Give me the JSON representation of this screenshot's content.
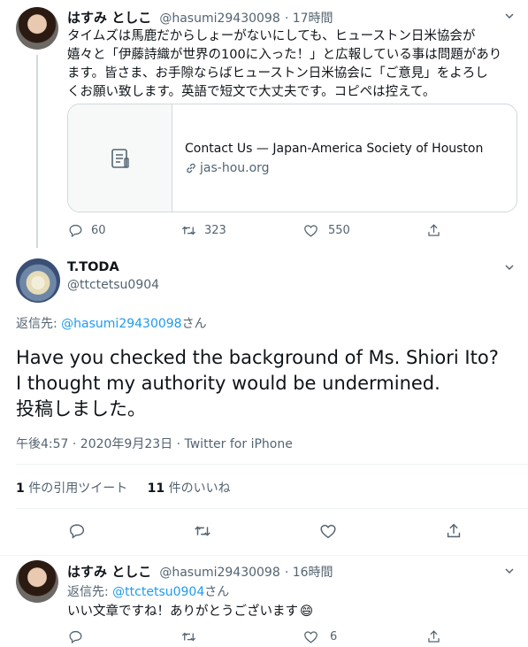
{
  "tweet1": {
    "name": "はすみ としこ",
    "handle": "@hasumi29430098",
    "time": "· 17時間",
    "text_lines": [
      "タイムズは馬鹿だからしょーがないにしても、ヒューストン日米協会が",
      "嬉々と「伊藤詩織が世界の100に入った！」と広報している事は問題があり",
      "ます。皆さま、お手隙ならばヒューストン日米協会に「ご意見」をよろし",
      "くお願い致します。英語で短文で大丈夫です。コピペは控えて。"
    ],
    "card": {
      "title": "Contact Us — Japan-America Society of Houston",
      "domain": "jas-hou.org"
    },
    "replies": "60",
    "retweets": "323",
    "likes": "550"
  },
  "main_tweet": {
    "name": "T.TODA",
    "handle": "@ttctetsu0904",
    "reply_prefix": "返信先: ",
    "reply_to": "@hasumi29430098",
    "reply_suffix": "さん",
    "text_lines": [
      "Have you checked the background of Ms. Shiori Ito?",
      "I thought my authority would be undermined.",
      "投稿しました。"
    ],
    "meta_time": "午後4:57 · 2020年9月23日 · ",
    "meta_source": "Twitter for iPhone",
    "quote_count": "1",
    "quote_label": " 件の引用ツイート",
    "like_count": "11",
    "like_label": " 件のいいね"
  },
  "tweet3": {
    "name": "はすみ としこ",
    "handle": "@hasumi29430098",
    "time": "· 16時間",
    "reply_prefix": "返信先: ",
    "reply_to": "@ttctetsu0904",
    "reply_suffix": "さん",
    "text": "いい文章ですね！ありがとうございます",
    "emoji": "😄",
    "likes": "6"
  },
  "colors": {
    "link": "#1d9bf0",
    "muted": "#536471",
    "text": "#0f1419",
    "border": "#cfd9de"
  },
  "icons": [
    "reply-icon",
    "retweet-icon",
    "like-icon",
    "share-icon",
    "chevron-down-icon",
    "document-icon",
    "link-icon"
  ]
}
